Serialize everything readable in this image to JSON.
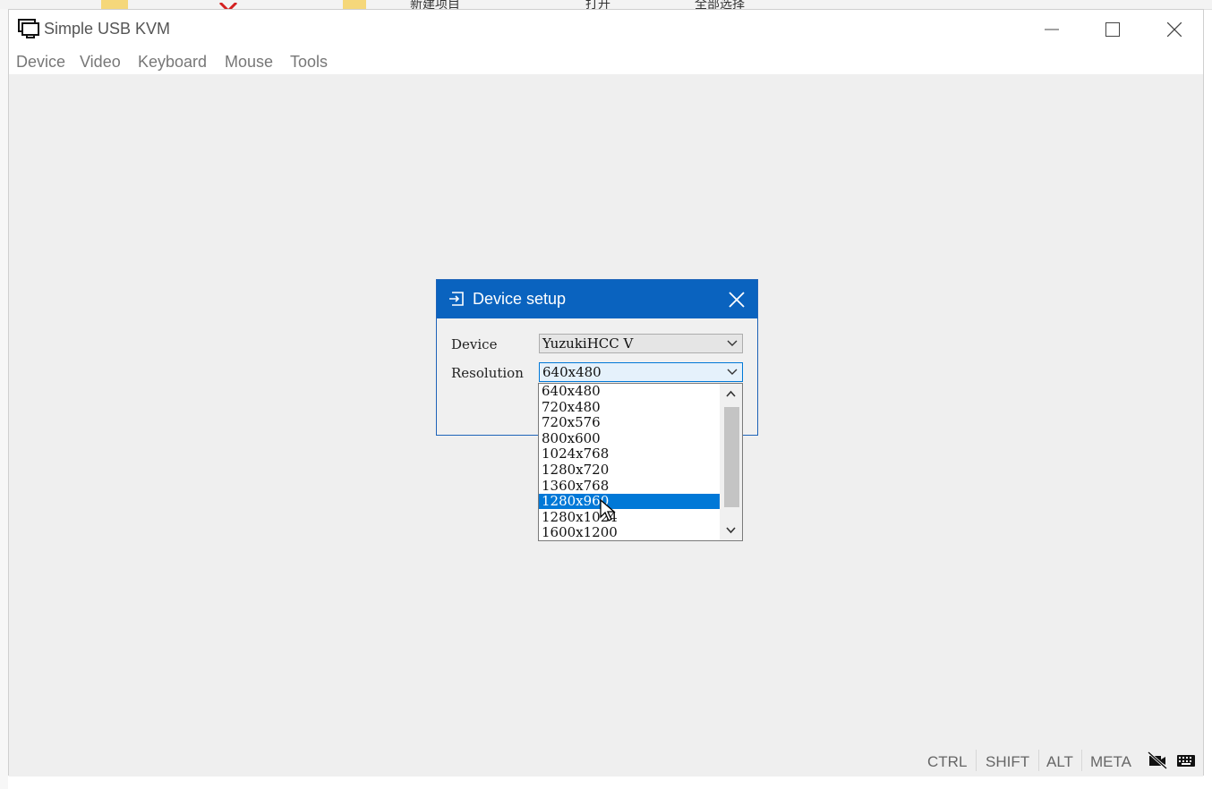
{
  "background_app": {
    "toolbar_items": [
      "新建项目",
      "打开",
      "全部选择"
    ]
  },
  "window": {
    "title": "Simple USB KVM",
    "icon": "monitor-icon",
    "menu": [
      "Device",
      "Video",
      "Keyboard",
      "Mouse",
      "Tools"
    ]
  },
  "statusbar": {
    "keys": [
      "CTRL",
      "SHIFT",
      "ALT",
      "META"
    ],
    "icons": [
      "camera-off-icon",
      "keyboard-icon"
    ]
  },
  "dialog": {
    "title": "Device setup",
    "icon": "device-login-icon",
    "device_label": "Device",
    "device_value": "YuzukiHCC V",
    "resolution_label": "Resolution",
    "resolution_value": "640x480",
    "resolution_options": [
      "640x480",
      "720x480",
      "720x576",
      "800x600",
      "1024x768",
      "1280x720",
      "1360x768",
      "1280x960",
      "1280x1024",
      "1600x1200"
    ],
    "highlighted_option": "1280x960"
  },
  "colors": {
    "dialog_title_bg": "#0a63bf",
    "selection": "#0078d7"
  }
}
